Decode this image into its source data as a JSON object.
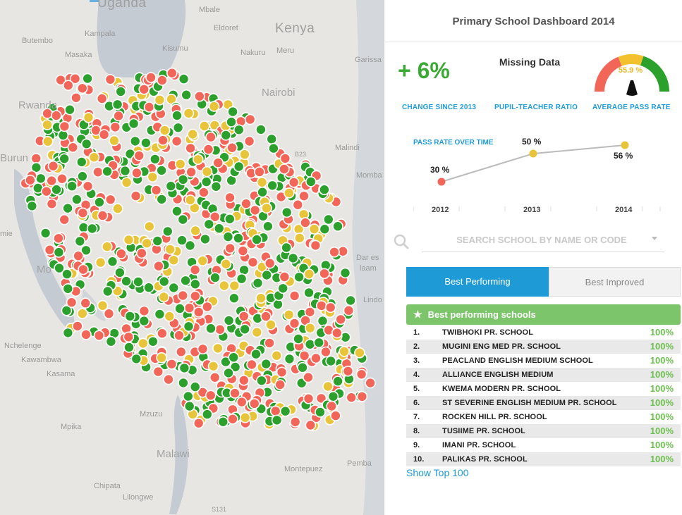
{
  "map": {
    "labels": [
      {
        "id": "uganda",
        "text": "Uganda",
        "size": "big"
      },
      {
        "id": "kenya",
        "text": "Kenya",
        "size": "big"
      },
      {
        "id": "mbale",
        "text": "Mbale"
      },
      {
        "id": "butembo",
        "text": "Butembo"
      },
      {
        "id": "kampala",
        "text": "Kampala"
      },
      {
        "id": "eldoret",
        "text": "Eldoret"
      },
      {
        "id": "masaka",
        "text": "Masaka"
      },
      {
        "id": "kisumu",
        "text": "Kisumu"
      },
      {
        "id": "nakuru",
        "text": "Nakuru"
      },
      {
        "id": "meru",
        "text": "Meru"
      },
      {
        "id": "garissa",
        "text": "Garissa"
      },
      {
        "id": "nairobi",
        "text": "Nairobi",
        "size": "mid"
      },
      {
        "id": "rwanda",
        "text": "Rwanda",
        "size": "mid"
      },
      {
        "id": "malindi",
        "text": "Malindi"
      },
      {
        "id": "burundi",
        "text": "Burun",
        "size": "mid"
      },
      {
        "id": "mombasa",
        "text": "Momba"
      },
      {
        "id": "dar",
        "text": "Dar es"
      },
      {
        "id": "salaam",
        "text": "laam"
      },
      {
        "id": "nchelenge",
        "text": "Nchelenge"
      },
      {
        "id": "kawambwa",
        "text": "Kawambwa"
      },
      {
        "id": "kasama",
        "text": "Kasama"
      },
      {
        "id": "mzuzu",
        "text": "Mzuzu"
      },
      {
        "id": "mpika",
        "text": "Mpika"
      },
      {
        "id": "malawi",
        "text": "Malawi",
        "size": "mid"
      },
      {
        "id": "chipata",
        "text": "Chipata"
      },
      {
        "id": "lilongwe",
        "text": "Lilongwe"
      },
      {
        "id": "montepuez",
        "text": "Montepuez"
      },
      {
        "id": "pemba",
        "text": "Pemba"
      },
      {
        "id": "mo",
        "text": "Mo"
      },
      {
        "id": "mie",
        "text": "mie"
      },
      {
        "id": "lindo",
        "text": "Lindo"
      },
      {
        "id": "s131",
        "text": "S131"
      },
      {
        "id": "b23",
        "text": "B23"
      }
    ],
    "colors": {
      "green": "#2ca02c",
      "red": "#f2665a",
      "yellow": "#e8c43a",
      "land": "#e8e6e2",
      "water": "#c4cbd3"
    }
  },
  "dashboard": {
    "title": "Primary School Dashboard 2014",
    "change_value": "+ 6%",
    "missing_text": "Missing Data",
    "gauge_value": "55.9 %",
    "labels": {
      "change": "CHANGE SINCE 2013",
      "ratio": "PUPIL-TEACHER RATIO",
      "pass": "AVERAGE PASS RATE"
    },
    "line_title": "PASS RATE OVER TIME"
  },
  "chart_data": {
    "type": "line",
    "x": [
      "2012",
      "2013",
      "2014"
    ],
    "values": [
      30,
      50,
      56
    ],
    "point_labels": [
      "30 %",
      "50 %",
      "56 %"
    ],
    "point_colors": [
      "#f2665a",
      "#e8c43a",
      "#e8c43a"
    ],
    "ylim": [
      0,
      100
    ]
  },
  "search": {
    "placeholder": "SEARCH SCHOOL BY NAME OR CODE"
  },
  "tabs": {
    "best_performing": "Best Performing",
    "best_improved": "Best Improved"
  },
  "list": {
    "header": "Best performing schools",
    "rows": [
      {
        "rank": "1.",
        "name": "TWIBHOKI PR. SCHOOL",
        "pct": "100%"
      },
      {
        "rank": "2.",
        "name": "MUGINI ENG MED PR. SCHOOL",
        "pct": "100%"
      },
      {
        "rank": "3.",
        "name": "PEACLAND ENGLISH MEDIUM SCHOOL",
        "pct": "100%"
      },
      {
        "rank": "4.",
        "name": "ALLIANCE ENGLISH MEDIUM",
        "pct": "100%"
      },
      {
        "rank": "5.",
        "name": "KWEMA MODERN PR. SCHOOL",
        "pct": "100%"
      },
      {
        "rank": "6.",
        "name": "ST SEVERINE ENGLISH MEDIUM PR. SCHOOL",
        "pct": "100%"
      },
      {
        "rank": "7.",
        "name": "ROCKEN HILL PR. SCHOOL",
        "pct": "100%"
      },
      {
        "rank": "8.",
        "name": "TUSIIME PR. SCHOOL",
        "pct": "100%"
      },
      {
        "rank": "9.",
        "name": "IMANI PR. SCHOOL",
        "pct": "100%"
      },
      {
        "rank": "10.",
        "name": "PALIKAS PR. SCHOOL",
        "pct": "100%"
      }
    ],
    "show_more": "Show Top 100"
  }
}
